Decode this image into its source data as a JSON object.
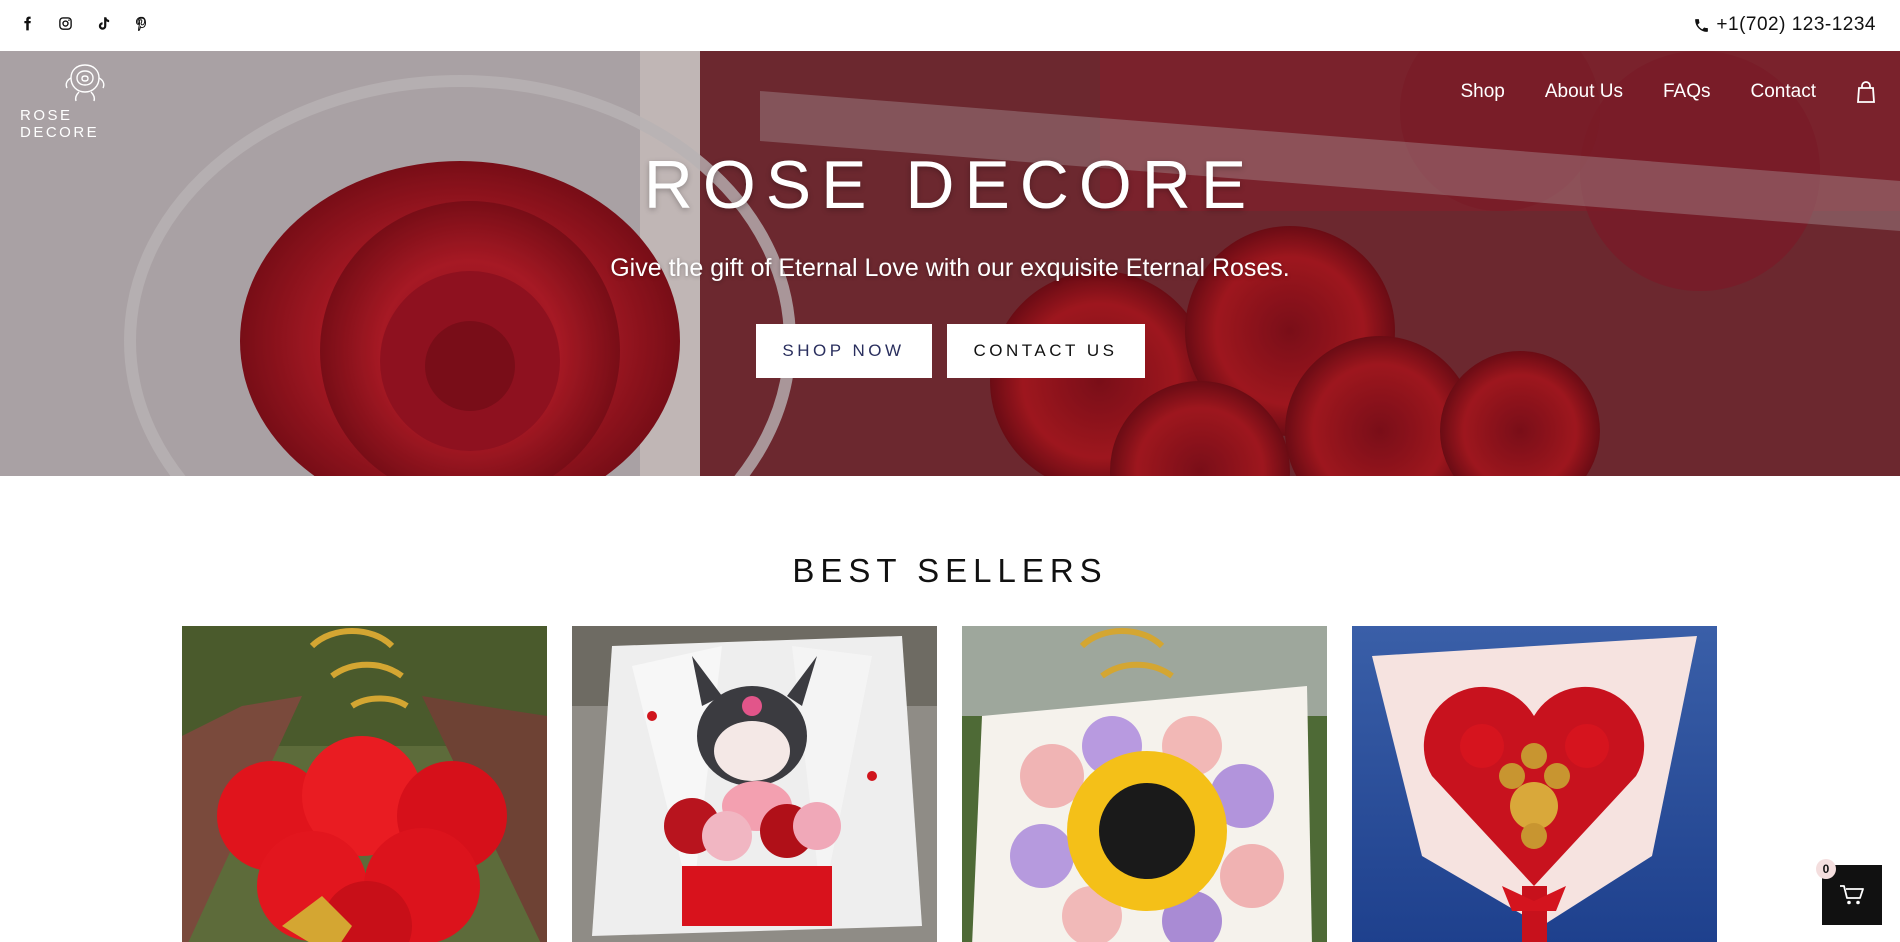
{
  "topbar": {
    "social_icons": [
      "facebook-icon",
      "instagram-icon",
      "tiktok-icon",
      "pinterest-icon"
    ],
    "phone": "+1(702) 123-1234"
  },
  "header": {
    "logo_text": "ROSE DECORE",
    "nav": [
      "Shop",
      "About Us",
      "FAQs",
      "Contact"
    ],
    "cart_icon": "shopping-bag-icon"
  },
  "hero": {
    "title": "ROSE DECORE",
    "subtitle": "Give the gift of Eternal Love with our exquisite Eternal Roses.",
    "primary_button": "SHOP NOW",
    "secondary_button": "CONTACT US"
  },
  "best_sellers": {
    "title": "BEST SELLERS",
    "products": [
      {
        "image": "red-rose-bouquet-happy-mothers-day"
      },
      {
        "image": "kuromi-plush-rose-bouquet"
      },
      {
        "image": "sunflower-rose-bouquet-happy-mothers-day"
      },
      {
        "image": "red-rose-heart-chocolate-bouquet"
      }
    ]
  },
  "cart": {
    "count": "0",
    "icon": "cart-icon"
  },
  "colors": {
    "accent_button_text": "#2a2f5e",
    "cart_bg": "#111111",
    "badge_bg": "#f4dede"
  }
}
